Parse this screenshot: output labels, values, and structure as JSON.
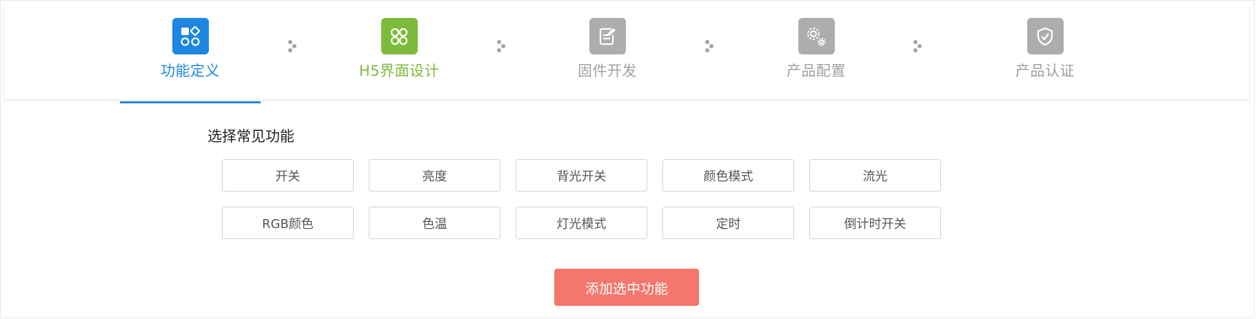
{
  "colors": {
    "active_blue": "#1d86e0",
    "done_green": "#7dbb3c",
    "inactive_gray": "#adadad",
    "inactive_text": "#a0a0a0",
    "button_salmon": "#f5776b"
  },
  "steps": [
    {
      "label": "功能定义",
      "icon": "blocks-icon",
      "state": "active"
    },
    {
      "label": "H5界面设计",
      "icon": "clover-icon",
      "state": "done"
    },
    {
      "label": "固件开发",
      "icon": "notepad-edit-icon",
      "state": "pending"
    },
    {
      "label": "产品配置",
      "icon": "gears-icon",
      "state": "pending"
    },
    {
      "label": "产品认证",
      "icon": "shield-check-icon",
      "state": "pending"
    }
  ],
  "section": {
    "title": "选择常见功能"
  },
  "features": [
    [
      "开关",
      "亮度",
      "背光开关",
      "颜色模式",
      "流光"
    ],
    [
      "RGB颜色",
      "色温",
      "灯光模式",
      "定时",
      "倒计时开关"
    ]
  ],
  "add_button": {
    "label": "添加选中功能"
  }
}
